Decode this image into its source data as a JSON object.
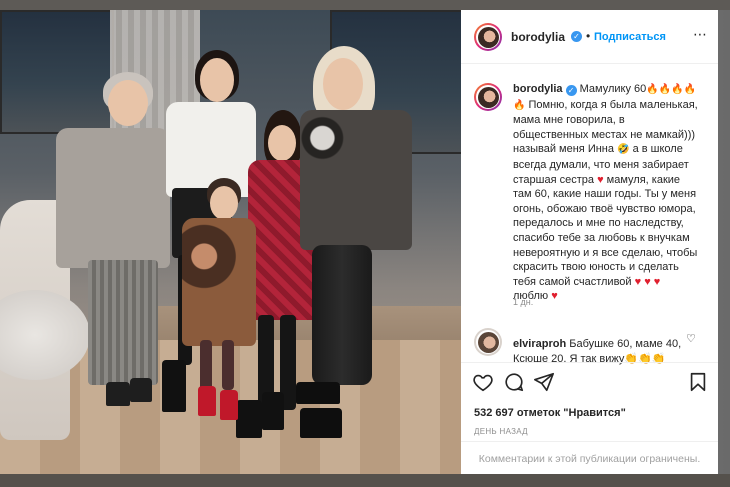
{
  "post": {
    "username": "borodylia",
    "verified": true,
    "follow_label": "Подписаться",
    "header_separator": "•",
    "more_icon": "more-dots-icon",
    "caption_lines": [
      "Мамулику 60",
      "Помню, когда я была маленькая,",
      "мама мне говорила, в",
      "общественных местах не мамкай)))",
      "называй меня Инна",
      "а в школе",
      "всегда думали, что меня забирает",
      "старшая сестра",
      "мамуля, какие",
      "там 60, какие наши годы. Ты у меня",
      "огонь, обожаю твоё чувство юмора,",
      "передалось и мне по наследству,",
      "спасибо тебе за любовь к внучкам",
      "невероятную и я все сделаю, чтобы",
      "скрасить твою юность и сделать",
      "тебя самой счастливой",
      "люблю"
    ],
    "emoji": {
      "fire": "🔥",
      "smile": "🤣",
      "heart": "♥"
    },
    "timestamp": "1 дн.",
    "comment": {
      "username": "elvirаproh",
      "text": "Бабушке 60, маме 40, Ксюше 20. Я так вижу",
      "clap": "👏👏👏"
    },
    "likes": "532 697 отметок \"Нравится\"",
    "date_label": "ДЕНЬ НАЗАД",
    "comments_disabled": "Комментарии к этой публикации ограничены."
  },
  "icons": {
    "like": "heart-icon",
    "comment": "comment-bubble-icon",
    "share": "paper-plane-icon",
    "save": "bookmark-icon"
  },
  "colors": {
    "accent": "#0095f6",
    "verified": "#3897f0",
    "text": "#262626",
    "muted": "#8e8e8e",
    "heart": "#e0202f"
  }
}
